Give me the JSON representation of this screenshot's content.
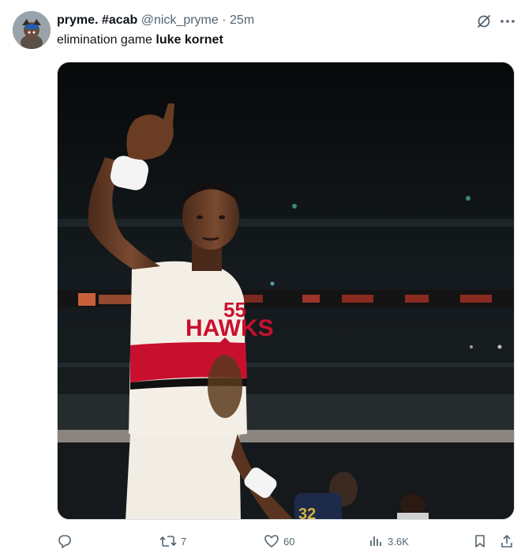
{
  "tweet": {
    "display_name": "pryme. #acab",
    "handle": "@nick_pryme",
    "separator": "·",
    "time": "25m",
    "text_prefix": "elimination game ",
    "text_bold": "luke kornet"
  },
  "media": {
    "description_icon": "photo",
    "jersey_front": "HAWKS",
    "jersey_number": "55",
    "opponent_number": "32"
  },
  "actions": {
    "reply_count": "",
    "retweet_count": "7",
    "like_count": "60",
    "view_count": "3.6K"
  },
  "colors": {
    "accent": "#1d9bf0",
    "muted": "#536471",
    "text": "#0f1419",
    "jersey_red": "#c8102e"
  },
  "icons": [
    "reply-icon",
    "retweet-icon",
    "like-icon",
    "views-icon",
    "bookmark-icon",
    "share-icon",
    "grok-icon",
    "more-icon"
  ]
}
